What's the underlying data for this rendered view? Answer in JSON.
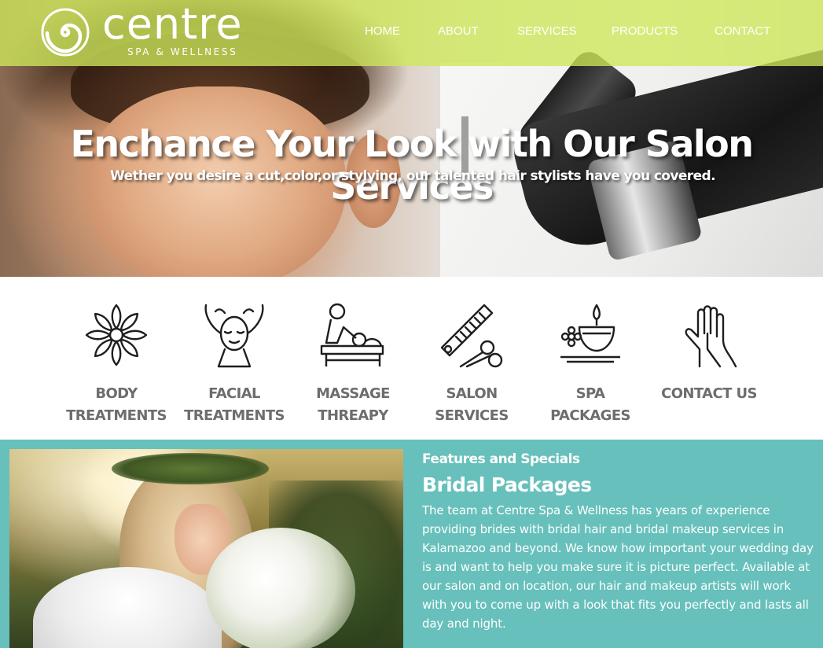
{
  "header": {
    "logo_text": "centre",
    "logo_tagline": "SPA & WELLNESS",
    "nav": [
      {
        "label": "HOME"
      },
      {
        "label": "ABOUT"
      },
      {
        "label": "SERVICES"
      },
      {
        "label": "PRODUCTS"
      },
      {
        "label": "CONTACT"
      }
    ]
  },
  "hero": {
    "title": "Enchance Your Look with Our Salon Services",
    "subtitle": "Wether you desire a cut,color,or stylying, our talented hair stylists have you covered."
  },
  "services": [
    {
      "line1": "BODY",
      "line2": "TREATMENTS",
      "icon": "lotus-icon"
    },
    {
      "line1": "FACIAL",
      "line2": "TREATMENTS",
      "icon": "facial-icon"
    },
    {
      "line1": "MASSAGE",
      "line2": "THREAPY",
      "icon": "massage-icon"
    },
    {
      "line1": "SALON",
      "line2": "SERVICES",
      "icon": "comb-scissors-icon"
    },
    {
      "line1": "SPA",
      "line2": "PACKAGES",
      "icon": "candle-bowl-icon"
    },
    {
      "line1": "CONTACT US",
      "line2": "",
      "icon": "hands-icon"
    }
  ],
  "feature": {
    "kicker": "Features and Specials",
    "title": "Bridal Packages",
    "body": "The team at Centre Spa & Wellness has years of experience providing brides with bridal hair and bridal makeup services in Kalamazoo and beyond. We know how important your wedding day is and want to help you make sure it is picture perfect. Available at our salon and on location, our hair and makeup artists will work with you to come up with a look that fits you perfectly and lasts all day and night."
  },
  "colors": {
    "header_green": "#cee85a",
    "feature_teal": "#67c0bb",
    "service_label_gray": "#6d6d6d"
  }
}
